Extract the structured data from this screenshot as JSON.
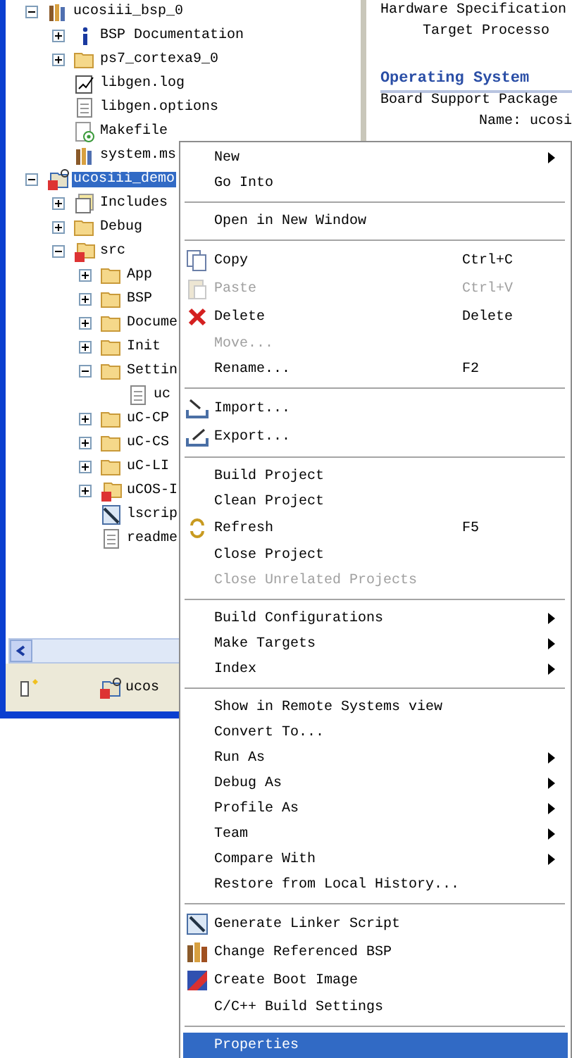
{
  "explorer": {
    "tree": [
      {
        "label": "ucosiii_bsp_0",
        "kind": "bsp",
        "expanded": true,
        "selected": false,
        "children": [
          {
            "label": "BSP Documentation",
            "kind": "info",
            "expanded": false,
            "selected": false
          },
          {
            "label": "ps7_cortexa9_0",
            "kind": "folder",
            "expanded": false,
            "selected": false
          },
          {
            "label": "libgen.log",
            "kind": "log",
            "selected": false
          },
          {
            "label": "libgen.options",
            "kind": "file",
            "selected": false
          },
          {
            "label": "Makefile",
            "kind": "makefile",
            "selected": false
          },
          {
            "label": "system.ms",
            "kind": "bsp",
            "selected": false
          }
        ]
      },
      {
        "label": "ucosiii_demo",
        "kind": "project",
        "expanded": true,
        "selected": true,
        "children": [
          {
            "label": "Includes",
            "kind": "includes",
            "expanded": false,
            "selected": false
          },
          {
            "label": "Debug",
            "kind": "folder",
            "expanded": false,
            "selected": false
          },
          {
            "label": "src",
            "kind": "srcfolder",
            "expanded": true,
            "selected": false,
            "children": [
              {
                "label": "App",
                "kind": "folder",
                "expanded": false,
                "selected": false
              },
              {
                "label": "BSP",
                "kind": "folder",
                "expanded": false,
                "selected": false
              },
              {
                "label": "Docume",
                "kind": "folder",
                "expanded": false,
                "selected": false
              },
              {
                "label": "Init",
                "kind": "folder",
                "expanded": false,
                "selected": false
              },
              {
                "label": "Settin",
                "kind": "folder",
                "expanded": true,
                "selected": false,
                "children": [
                  {
                    "label": "uc",
                    "kind": "file",
                    "selected": false
                  }
                ]
              },
              {
                "label": "uC-CP",
                "kind": "folder",
                "expanded": false,
                "selected": false
              },
              {
                "label": "uC-CS",
                "kind": "folder",
                "expanded": false,
                "selected": false
              },
              {
                "label": "uC-LI",
                "kind": "folder",
                "expanded": false,
                "selected": false
              },
              {
                "label": "uCOS-I",
                "kind": "srcfolder",
                "expanded": false,
                "selected": false
              },
              {
                "label": "lscrip",
                "kind": "linker",
                "selected": false
              },
              {
                "label": "readme",
                "kind": "file",
                "selected": false
              }
            ]
          }
        ]
      }
    ],
    "bottom_tab": "ucos"
  },
  "editor": {
    "hardware_spec": "Hardware Specification",
    "target_processor": "Target Processo",
    "section_title": "Operating System",
    "bsp_label": "Board Support Package",
    "name_label": "Name:",
    "name_value": "ucosi"
  },
  "context_menu": {
    "sections": [
      [
        {
          "label": "New",
          "submenu": true,
          "disabled": false,
          "selected": false
        },
        {
          "label": "Go Into",
          "disabled": false,
          "selected": false
        }
      ],
      [
        {
          "label": "Open in New Window",
          "disabled": false,
          "selected": false
        }
      ],
      [
        {
          "label": "Copy",
          "kind": "copy",
          "shortcut": "Ctrl+C",
          "disabled": false,
          "selected": false
        },
        {
          "label": "Paste",
          "kind": "paste",
          "shortcut": "Ctrl+V",
          "disabled": true,
          "selected": false
        },
        {
          "label": "Delete",
          "kind": "delete",
          "shortcut": "Delete",
          "disabled": false,
          "selected": false
        },
        {
          "label": "Move...",
          "disabled": true,
          "selected": false
        },
        {
          "label": "Rename...",
          "shortcut": "F2",
          "disabled": false,
          "selected": false
        }
      ],
      [
        {
          "label": "Import...",
          "kind": "import",
          "disabled": false,
          "selected": false
        },
        {
          "label": "Export...",
          "kind": "export",
          "disabled": false,
          "selected": false
        }
      ],
      [
        {
          "label": "Build Project",
          "disabled": false,
          "selected": false
        },
        {
          "label": "Clean Project",
          "disabled": false,
          "selected": false
        },
        {
          "label": "Refresh",
          "kind": "refresh",
          "shortcut": "F5",
          "disabled": false,
          "selected": false
        },
        {
          "label": "Close Project",
          "disabled": false,
          "selected": false
        },
        {
          "label": "Close Unrelated Projects",
          "disabled": true,
          "selected": false
        }
      ],
      [
        {
          "label": "Build Configurations",
          "submenu": true,
          "disabled": false,
          "selected": false
        },
        {
          "label": "Make Targets",
          "submenu": true,
          "disabled": false,
          "selected": false
        },
        {
          "label": "Index",
          "submenu": true,
          "disabled": false,
          "selected": false
        }
      ],
      [
        {
          "label": "Show in Remote Systems view",
          "disabled": false,
          "selected": false
        },
        {
          "label": "Convert To...",
          "disabled": false,
          "selected": false
        },
        {
          "label": "Run As",
          "submenu": true,
          "disabled": false,
          "selected": false
        },
        {
          "label": "Debug As",
          "submenu": true,
          "disabled": false,
          "selected": false
        },
        {
          "label": "Profile As",
          "submenu": true,
          "disabled": false,
          "selected": false
        },
        {
          "label": "Team",
          "submenu": true,
          "disabled": false,
          "selected": false
        },
        {
          "label": "Compare With",
          "submenu": true,
          "disabled": false,
          "selected": false
        },
        {
          "label": "Restore from Local History...",
          "disabled": false,
          "selected": false
        }
      ],
      [
        {
          "label": "Generate Linker Script",
          "kind": "linker",
          "disabled": false,
          "selected": false
        },
        {
          "label": "Change Referenced BSP",
          "kind": "bsp",
          "disabled": false,
          "selected": false
        },
        {
          "label": "Create Boot Image",
          "kind": "boot",
          "disabled": false,
          "selected": false
        },
        {
          "label": "C/C++ Build Settings",
          "disabled": false,
          "selected": false
        }
      ],
      [
        {
          "label": "Properties",
          "disabled": false,
          "selected": true
        }
      ]
    ]
  }
}
